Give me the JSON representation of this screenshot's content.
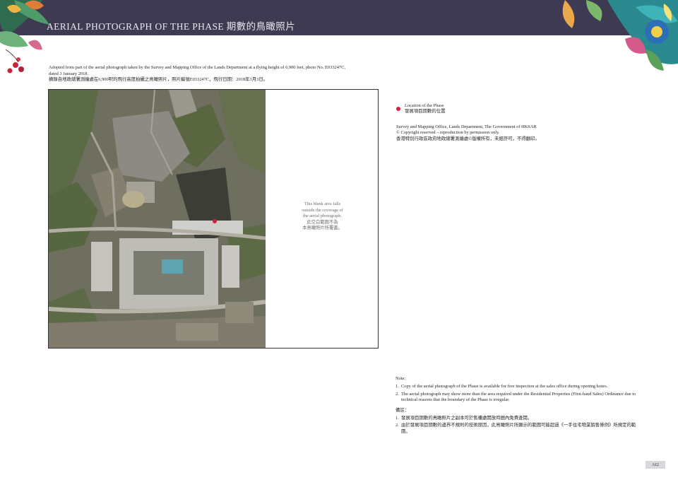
{
  "header": {
    "title": "AERIAL PHOTOGRAPH OF THE PHASE  期數的鳥瞰照片"
  },
  "intro": {
    "en": "Adopted from part of the aerial photograph taken by the Survey and Mapping Office of the Lands Department at a flying height of 6,900 feet, photo No. E033247C, dated 3 January 2018.",
    "zh": "摘錄自地政總署測繪處在6,900呎的飛行高度拍攝之鳥瞰照片，照片編號E033247C，飛行日期：2018年1月3日。"
  },
  "blank_note": {
    "en_lines": [
      "This blank area falls",
      "outside the coverage of",
      "the aerial photograph."
    ],
    "zh_lines": [
      "此空白範圍不為",
      "本鳥瞰照片所覆蓋。"
    ]
  },
  "legend": {
    "en": "Location of the Phase",
    "zh": "發展項目期數的位置",
    "dot_color": "#d81e3c"
  },
  "credit": {
    "line1": "Survey and Mapping Office, Lands Department, The Government of HKSAR",
    "line2": "© Copyright reserved – reproduction by permission only.",
    "line3": "香港特別行政區政府地政總署測繪處©版權所有，未經許可，不得翻印。"
  },
  "notes": {
    "heading_en": "Note:",
    "items_en": [
      {
        "num": "1.",
        "text": "Copy of the aerial photograph of the Phase is available for free inspection at the sales office during opening hours."
      },
      {
        "num": "2.",
        "text": "The aerial photograph may show more than the area required under the Residential Properties (First-hand Sales) Ordinance due to technical reasons that the boundary of the Phase is irregular."
      }
    ],
    "heading_zh": "備註：",
    "items_zh": [
      {
        "num": "1.",
        "text": "發展項目期數的鳥瞰照片之副本可於售樓處開放時間內免費查閱。"
      },
      {
        "num": "2.",
        "text": "由於發展項目期數的邊界不規則的技術原因，此鳥瞰照片所顯示的範圍可能超過《一手住宅物業銷售條例》所規定的範圍。"
      }
    ]
  },
  "page": {
    "number": "AI2"
  },
  "colors": {
    "header_band": "#3e3a52",
    "accent_red": "#d81e3c"
  }
}
